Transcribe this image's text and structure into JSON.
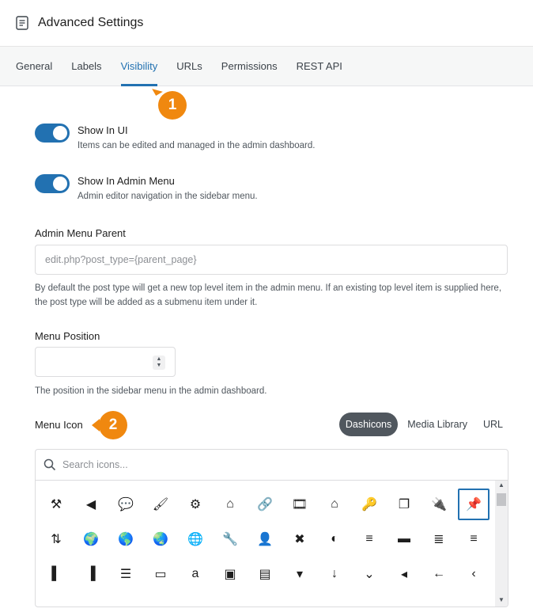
{
  "header": {
    "title": "Advanced Settings"
  },
  "tabs": [
    {
      "label": "General"
    },
    {
      "label": "Labels"
    },
    {
      "label": "Visibility",
      "active": true
    },
    {
      "label": "URLs"
    },
    {
      "label": "Permissions"
    },
    {
      "label": "REST API"
    }
  ],
  "callouts": {
    "one": "1",
    "two": "2"
  },
  "toggles": {
    "show_in_ui": {
      "label": "Show In UI",
      "help": "Items can be edited and managed in the admin dashboard.",
      "on": true
    },
    "show_in_menu": {
      "label": "Show In Admin Menu",
      "help": "Admin editor navigation in the sidebar menu.",
      "on": true
    }
  },
  "menu_parent": {
    "label": "Admin Menu Parent",
    "placeholder": "edit.php?post_type={parent_page}",
    "help": "By default the post type will get a new top level item in the admin menu. If an existing top level item is supplied here, the post type will be added as a submenu item under it."
  },
  "menu_position": {
    "label": "Menu Position",
    "value": "",
    "help": "The position in the sidebar menu in the admin dashboard."
  },
  "menu_icon": {
    "label": "Menu Icon",
    "sources": [
      "Dashicons",
      "Media Library",
      "URL"
    ],
    "active_source": "Dashicons",
    "search_placeholder": "Search icons...",
    "selected_icon": "admin-post",
    "icons": [
      {
        "name": "hammer",
        "glyph": "⚒"
      },
      {
        "name": "arrow-left-circle",
        "glyph": "◀"
      },
      {
        "name": "comment",
        "glyph": "💬"
      },
      {
        "name": "brush",
        "glyph": "🖌"
      },
      {
        "name": "gear",
        "glyph": "⚙"
      },
      {
        "name": "home",
        "glyph": "⌂"
      },
      {
        "name": "link",
        "glyph": "🔗"
      },
      {
        "name": "media",
        "glyph": "🎞"
      },
      {
        "name": "network",
        "glyph": "⌂"
      },
      {
        "name": "key",
        "glyph": "🔑"
      },
      {
        "name": "pages",
        "glyph": "❐"
      },
      {
        "name": "plugins",
        "glyph": "🔌"
      },
      {
        "name": "pin",
        "glyph": "📌"
      },
      {
        "name": "sort",
        "glyph": "⇅"
      },
      {
        "name": "globe-site",
        "glyph": "🌍"
      },
      {
        "name": "globe-alt",
        "glyph": "🌎"
      },
      {
        "name": "globe-dark",
        "glyph": "🌏"
      },
      {
        "name": "globe-grid",
        "glyph": "🌐"
      },
      {
        "name": "tools",
        "glyph": "🔧"
      },
      {
        "name": "users",
        "glyph": "👤"
      },
      {
        "name": "cross-tools",
        "glyph": "✖"
      },
      {
        "name": "contrast",
        "glyph": "◐"
      },
      {
        "name": "align-center",
        "glyph": "≡"
      },
      {
        "name": "monitor",
        "glyph": "▬"
      },
      {
        "name": "align-right",
        "glyph": "≣"
      },
      {
        "name": "align-left",
        "glyph": "≡"
      },
      {
        "name": "align-pull-left",
        "glyph": "▌"
      },
      {
        "name": "align-pull-right",
        "glyph": "▐"
      },
      {
        "name": "list-indent",
        "glyph": "☰"
      },
      {
        "name": "printer",
        "glyph": "▭"
      },
      {
        "name": "amazon",
        "glyph": "a"
      },
      {
        "name": "id-card",
        "glyph": "▣"
      },
      {
        "name": "archive",
        "glyph": "▤"
      },
      {
        "name": "caret-down",
        "glyph": "▾"
      },
      {
        "name": "arrow-down",
        "glyph": "↓"
      },
      {
        "name": "chevron-down",
        "glyph": "⌄"
      },
      {
        "name": "caret-left",
        "glyph": "◂"
      },
      {
        "name": "arrow-left",
        "glyph": "←"
      },
      {
        "name": "chevron-left",
        "glyph": "‹"
      }
    ]
  }
}
